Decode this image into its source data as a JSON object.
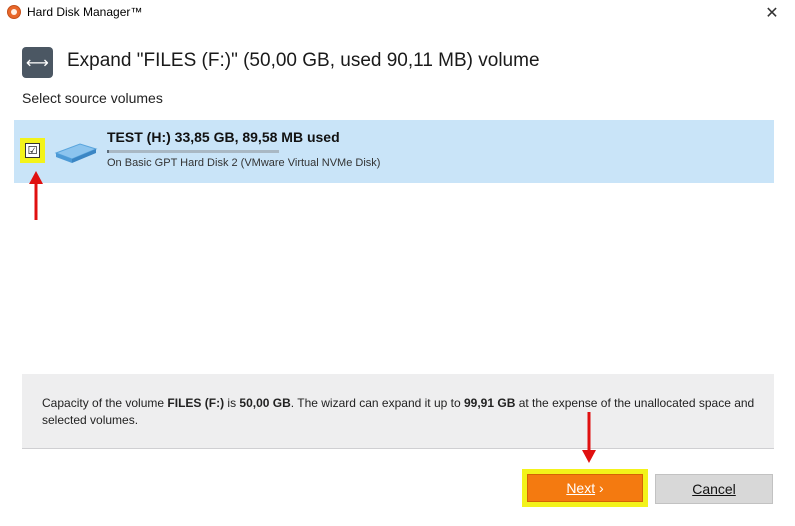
{
  "window": {
    "title": "Hard Disk Manager™",
    "close_glyph": "✕"
  },
  "header": {
    "icon": "expand-arrows-icon",
    "icon_glyph": "⟷",
    "title": "Expand \"FILES (F:)\" (50,00 GB, used 90,11 MB) volume"
  },
  "source": {
    "label": "Select source volumes",
    "volumes": [
      {
        "name": "TEST (H:) 33,85 GB, 89,58 MB used",
        "disk": "On Basic GPT Hard Disk 2 (VMware Virtual NVMe Disk)",
        "checked": true,
        "check_glyph": "☑",
        "used_fraction": 0.003
      }
    ]
  },
  "info": {
    "p1": "Capacity of the volume ",
    "volume": "FILES (F:)",
    "p2": " is ",
    "capacity": "50,00 GB",
    "p3": ". The wizard can expand it up to ",
    "max": "99,91 GB",
    "p4": " at the expense of the unallocated space and selected volumes."
  },
  "buttons": {
    "next": "Next",
    "next_glyph": " ›",
    "cancel": "Cancel"
  },
  "colors": {
    "accent": "#f47a10",
    "selection": "#c9e4f8",
    "highlight": "#f3f31a",
    "annotation_arrow": "#e01010"
  }
}
